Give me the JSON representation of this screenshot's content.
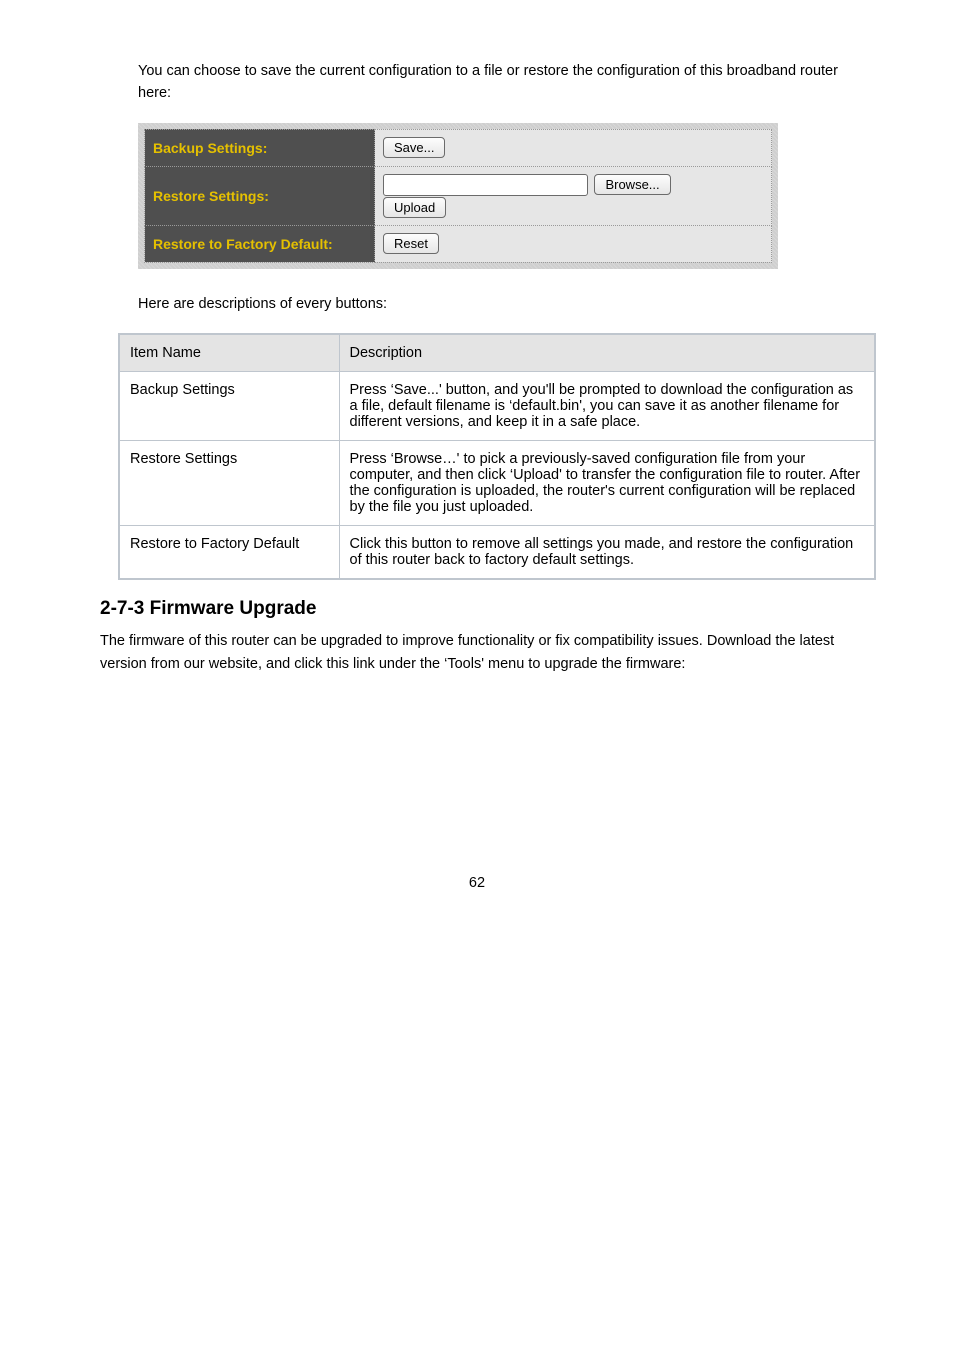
{
  "intro": "You can choose to save the current configuration to a file or restore the configuration of this broadband router here:",
  "panel": {
    "rows": [
      {
        "label": "Backup Settings:",
        "buttons": [
          {
            "text": "Save..."
          }
        ]
      },
      {
        "label": "Restore Settings:",
        "file": true,
        "browse": "Browse...",
        "buttons": [
          {
            "text": "Upload"
          }
        ]
      },
      {
        "label": "Restore to Factory Default:",
        "buttons": [
          {
            "text": "Reset"
          }
        ]
      }
    ]
  },
  "desc": "Here are descriptions of every buttons:",
  "table": {
    "headers": [
      "Item Name",
      "Description"
    ],
    "rows": [
      {
        "name": "Backup Settings",
        "text": "Press ‘Save...' button, and you'll be prompted to download the configuration as a file, default filename is ‘default.bin', you can save it as another filename for different versions, and keep it in a safe place."
      },
      {
        "name": "Restore Settings",
        "text": "Press ‘Browse…' to pick a previously-saved configuration file from your computer, and then click ‘Upload' to transfer the configuration file to router. After the configuration is uploaded, the router's current configuration will be replaced by the file you just uploaded."
      },
      {
        "name": "Restore to Factory Default",
        "text": "Click this button to remove all settings you made, and restore the configuration of this router back to factory default settings."
      }
    ]
  },
  "section": "2-7-3 Firmware Upgrade",
  "body": "The firmware of this router can be upgraded to improve functionality or fix compatibility issues. Download the latest version from our website, and click this link under the ‘Tools' menu to upgrade the firmware:",
  "page_footer": "62"
}
